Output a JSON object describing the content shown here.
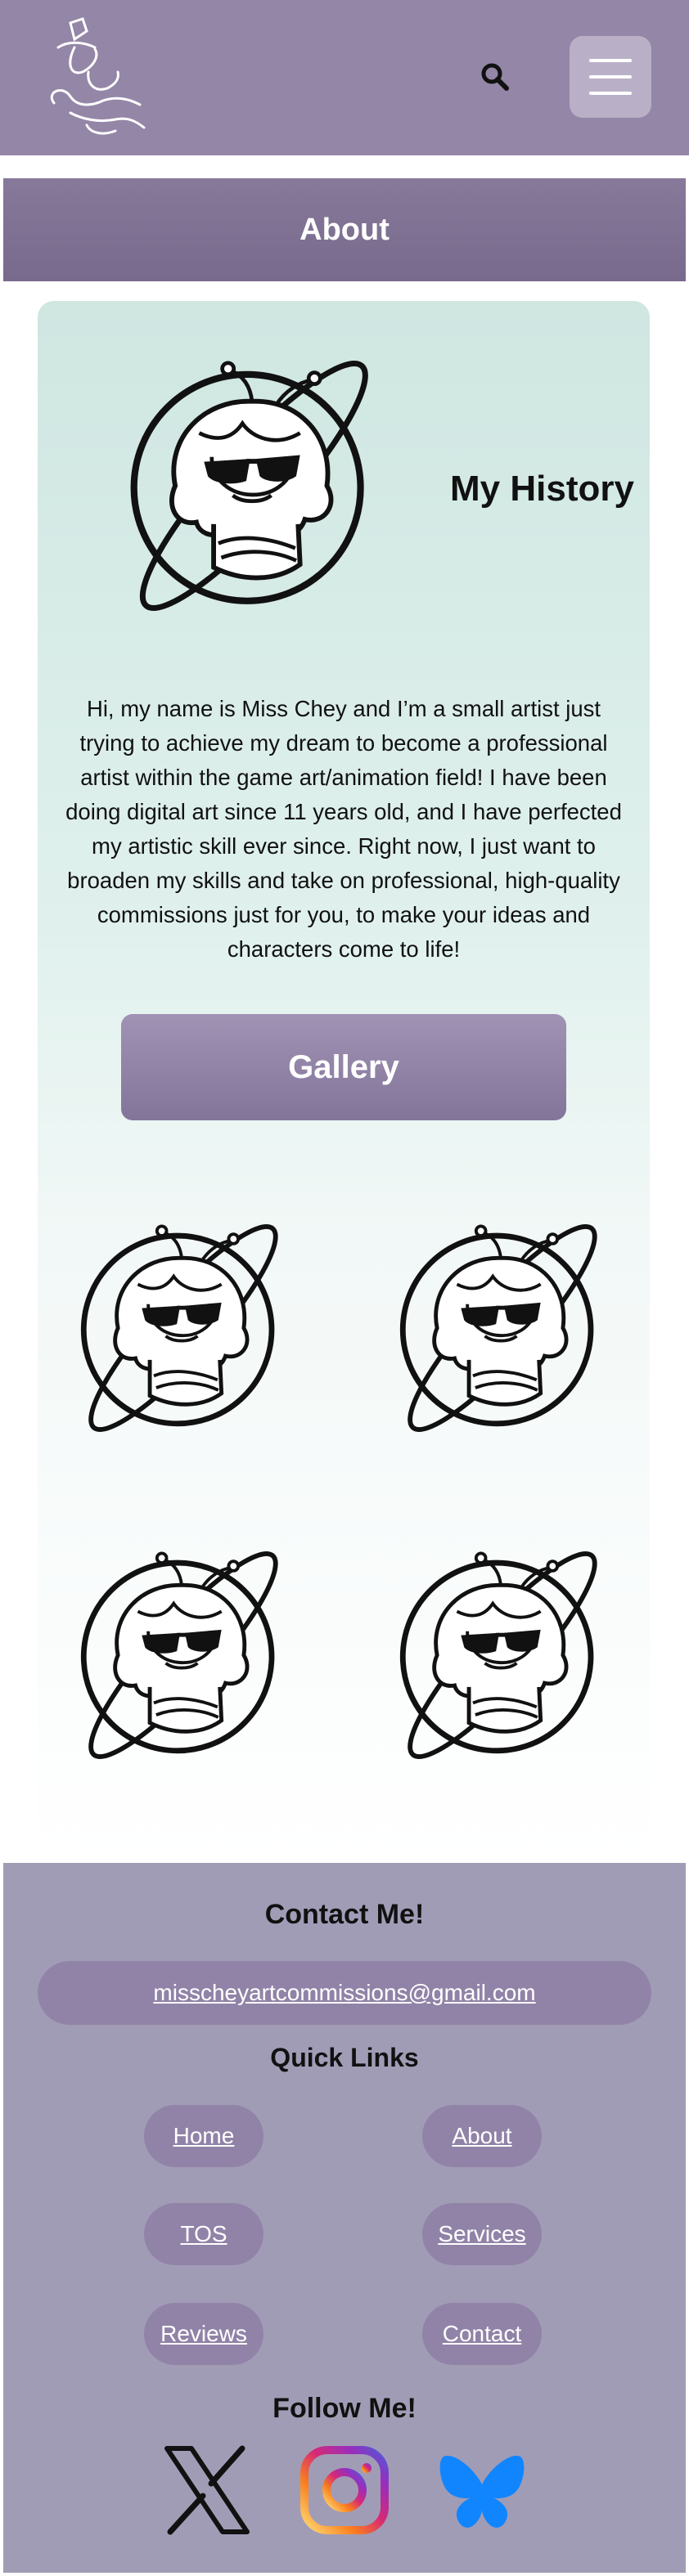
{
  "header": {
    "logo_text": "Miss Chey's Commissions Site",
    "search_icon": "search-icon",
    "menu_icon": "hamburger-menu-icon",
    "background_color": "#9486a7"
  },
  "about_banner": {
    "title": "About"
  },
  "history": {
    "title": "My History",
    "body": "Hi, my name is Miss Chey and I’m a small artist just trying to achieve my dream to become a professional artist within the game art/animation field! I have been doing digital art since 11 years old, and I have perfected my artistic skill ever since. Right now, I just want to broaden my skills and take on professional, high-quality commissions just for you, to make your ideas and characters come to life!",
    "avatar_icon": "artist-avatar-icon"
  },
  "gallery": {
    "button_label": "Gallery",
    "items": [
      "artist-avatar-icon",
      "artist-avatar-icon",
      "artist-avatar-icon",
      "artist-avatar-icon"
    ]
  },
  "footer": {
    "contact_title": "Contact Me!",
    "email": "misscheyartcommissions@gmail.com",
    "quick_links_title": "Quick Links",
    "links": [
      "Home",
      "About",
      "TOS",
      "Services",
      "Reviews",
      "Contact"
    ],
    "follow_title": "Follow Me!",
    "socials": [
      "x-icon",
      "instagram-icon",
      "bluesky-icon"
    ],
    "background_color": "#a19cb6",
    "pill_color": "#9183a7"
  }
}
